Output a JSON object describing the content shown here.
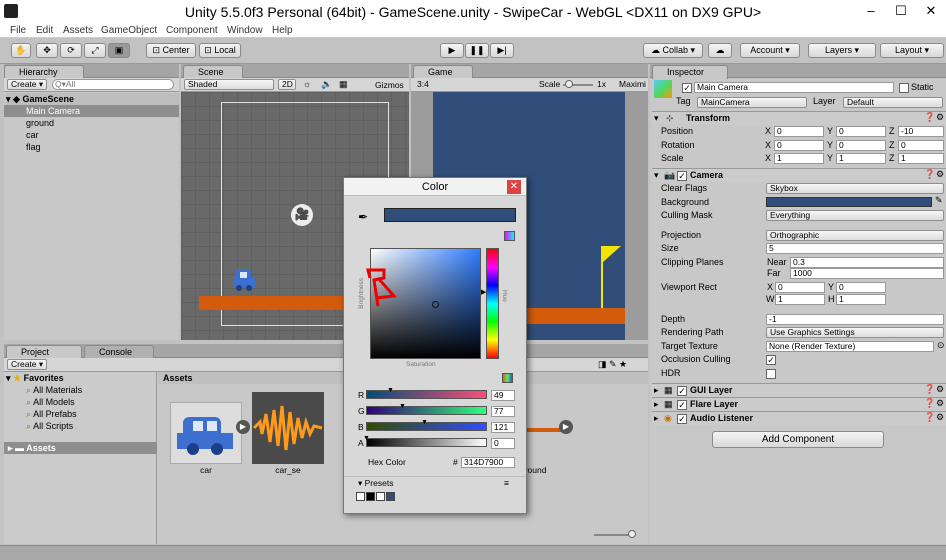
{
  "window": {
    "title": "Unity 5.5.0f3 Personal (64bit) - GameScene.unity - SwipeCar - WebGL <DX11 on DX9 GPU>"
  },
  "menu": [
    "File",
    "Edit",
    "Assets",
    "GameObject",
    "Component",
    "Window",
    "Help"
  ],
  "toolbar": {
    "center": "Center",
    "local": "Local",
    "collab": "Collab",
    "account": "Account",
    "layers": "Layers",
    "layout": "Layout"
  },
  "hierarchy": {
    "tab": "Hierarchy",
    "create": "Create",
    "search_placeholder": "Q▾All",
    "scene": "GameScene",
    "items": [
      "Main Camera",
      "ground",
      "car",
      "flag"
    ]
  },
  "scene": {
    "tab": "Scene",
    "shading": "Shaded",
    "mode2d": "2D",
    "gizmos": "Gizmos"
  },
  "game": {
    "tab": "Game",
    "aspect": "3:4",
    "scale_label": "Scale",
    "scale_value": "1x",
    "maximize": "Maximi"
  },
  "project": {
    "tab": "Project",
    "console_tab": "Console",
    "create": "Create",
    "favorites": "Favorites",
    "fav_items": [
      "All Materials",
      "All Models",
      "All Prefabs",
      "All Scripts"
    ],
    "assets_root": "Assets",
    "breadcrumb": "Assets",
    "assets": [
      "car",
      "car_se",
      "ground"
    ]
  },
  "inspector": {
    "tab": "Inspector",
    "object_name": "Main Camera",
    "static_label": "Static",
    "tag_label": "Tag",
    "tag_value": "MainCamera",
    "layer_label": "Layer",
    "layer_value": "Default",
    "transform": {
      "title": "Transform",
      "position": {
        "label": "Position",
        "x": "0",
        "y": "0",
        "z": "-10"
      },
      "rotation": {
        "label": "Rotation",
        "x": "0",
        "y": "0",
        "z": "0"
      },
      "scale": {
        "label": "Scale",
        "x": "1",
        "y": "1",
        "z": "1"
      }
    },
    "camera": {
      "title": "Camera",
      "clear_flags_label": "Clear Flags",
      "clear_flags": "Skybox",
      "background_label": "Background",
      "culling_label": "Culling Mask",
      "culling": "Everything",
      "projection_label": "Projection",
      "projection": "Orthographic",
      "size_label": "Size",
      "size": "5",
      "clipping_label": "Clipping Planes",
      "near_label": "Near",
      "near": "0.3",
      "far_label": "Far",
      "far": "1000",
      "viewport_label": "Viewport Rect",
      "vp_x": "0",
      "vp_y": "0",
      "vp_w": "1",
      "vp_h": "1",
      "depth_label": "Depth",
      "depth": "-1",
      "rendering_label": "Rendering Path",
      "rendering": "Use Graphics Settings",
      "target_label": "Target Texture",
      "target": "None (Render Texture)",
      "occlusion_label": "Occlusion Culling",
      "hdr_label": "HDR"
    },
    "components": [
      "GUI Layer",
      "Flare Layer",
      "Audio Listener"
    ],
    "add_component": "Add Component",
    "axis": {
      "x": "X",
      "y": "Y",
      "z": "Z",
      "w": "W",
      "h": "H"
    }
  },
  "color_picker": {
    "title": "Color",
    "brightness": "Brightness",
    "saturation": "Saturation",
    "hue": "Hue",
    "r_label": "R",
    "g_label": "G",
    "b_label": "B",
    "a_label": "A",
    "r": "49",
    "g": "77",
    "b": "121",
    "a": "0",
    "hex_label": "Hex Color",
    "hash": "#",
    "hex": "314D7900",
    "presets": "Presets"
  },
  "colors": {
    "background": "#314D79",
    "ground": "#D35C0C",
    "flag": "#F5E400",
    "car": "#3D6FD0"
  }
}
